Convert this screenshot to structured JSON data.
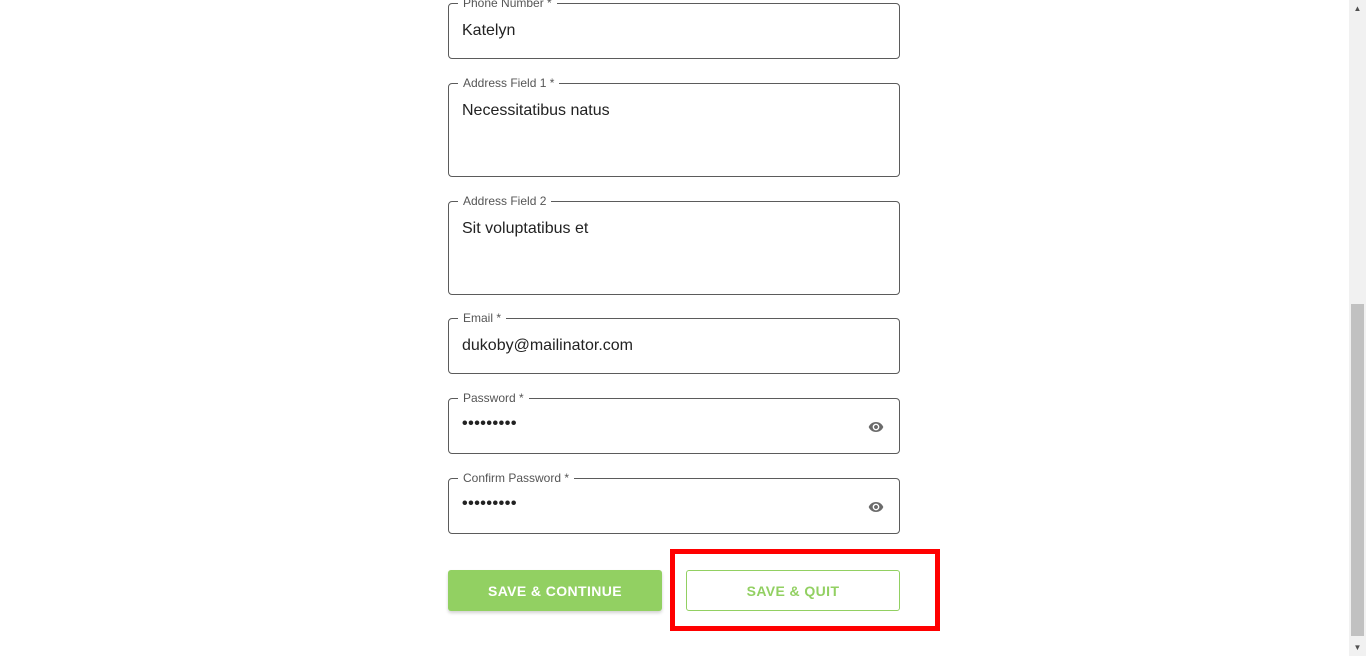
{
  "form": {
    "phone": {
      "label": "Phone Number *",
      "value": "Katelyn"
    },
    "address1": {
      "label": "Address Field 1 *",
      "value": "Necessitatibus natus"
    },
    "address2": {
      "label": "Address Field 2",
      "value": "Sit voluptatibus et"
    },
    "email": {
      "label": "Email *",
      "value": "dukoby@mailinator.com"
    },
    "password": {
      "label": "Password *",
      "value": "•••••••••"
    },
    "confirm_password": {
      "label": "Confirm Password *",
      "value": "•••••••••"
    }
  },
  "actions": {
    "save_continue_label": "SAVE & CONTINUE",
    "save_quit_label": "SAVE & QUIT"
  },
  "colors": {
    "accent_green": "#92d062",
    "highlight_red": "#ff0000"
  },
  "icons": {
    "password_toggle": "eye-icon"
  }
}
